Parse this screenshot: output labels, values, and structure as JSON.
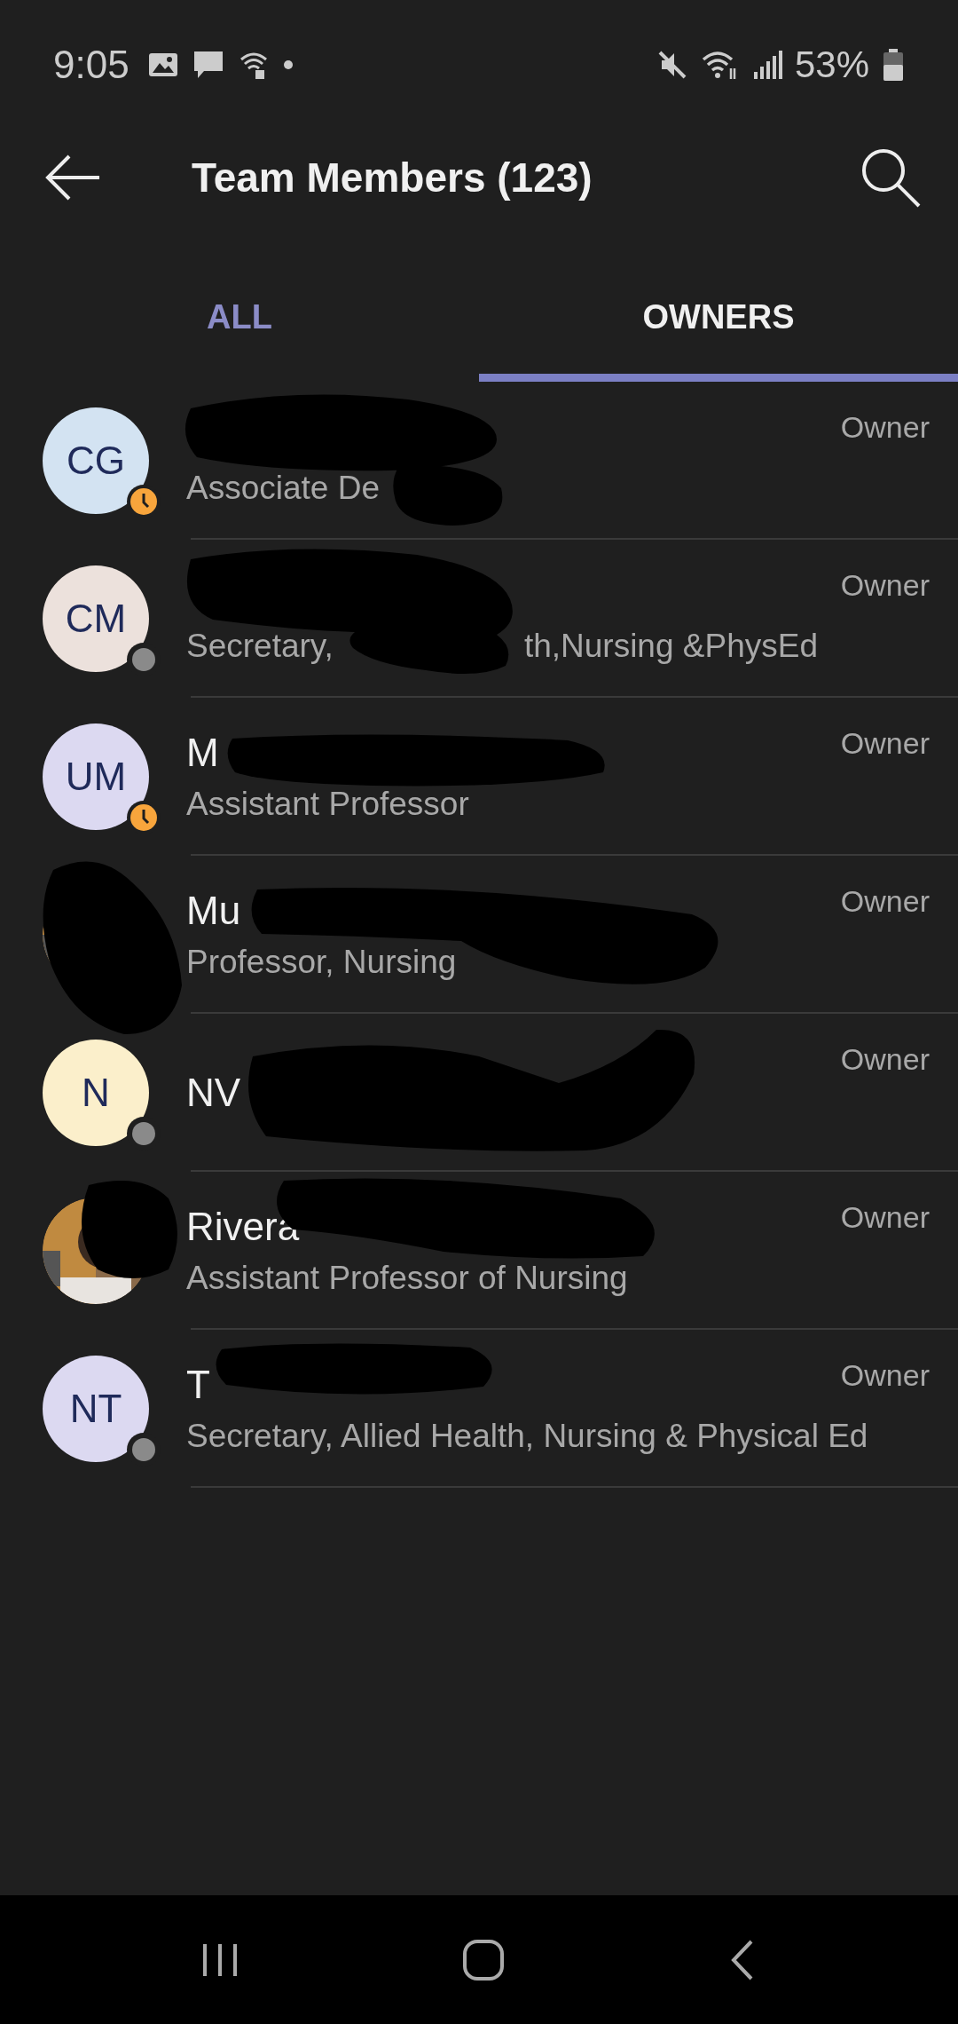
{
  "status_bar": {
    "time": "9:05",
    "battery": "53%"
  },
  "header": {
    "title": "Team Members (123)"
  },
  "tabs": [
    {
      "label": "ALL",
      "selected": false
    },
    {
      "label": "OWNERS",
      "selected": true
    }
  ],
  "members": [
    {
      "avatar": {
        "kind": "initials",
        "initials": "CG",
        "color": "#d3e3f2"
      },
      "status_icon": {
        "kind": "away"
      },
      "title": [
        "Associate De"
      ],
      "role": "Owner"
    },
    {
      "avatar": {
        "kind": "initials",
        "initials": "CM",
        "color": "#ece1dc"
      },
      "status_icon": {
        "kind": "offline"
      },
      "title": [
        "Secretary,",
        "th,Nursing &PhysEd"
      ],
      "role": "Owner"
    },
    {
      "avatar": {
        "kind": "initials",
        "initials": "UM",
        "color": "#dcd9f1"
      },
      "status_icon": {
        "kind": "away"
      },
      "name": "M",
      "title": [
        "Assistant Professor"
      ],
      "role": "Owner"
    },
    {
      "avatar": {
        "kind": "picture"
      },
      "name": "Mu",
      "title": [
        "Professor, Nursing"
      ],
      "role": "Owner"
    },
    {
      "avatar": {
        "kind": "initials",
        "initials": "N",
        "color": "#fbefcb"
      },
      "status_icon": {
        "kind": "offline"
      },
      "name": "NV",
      "role": "Owner"
    },
    {
      "avatar": {
        "kind": "picture"
      },
      "name": "Rivera",
      "title": [
        "Assistant Professor of Nursing"
      ],
      "role": "Owner"
    },
    {
      "avatar": {
        "kind": "initials",
        "initials": "NT",
        "color": "#dcd9f1"
      },
      "status_icon": {
        "kind": "offline"
      },
      "name": "T",
      "title": [
        "Secretary, Allied Health, Nursing & Physical Ed"
      ],
      "role": "Owner"
    }
  ]
}
